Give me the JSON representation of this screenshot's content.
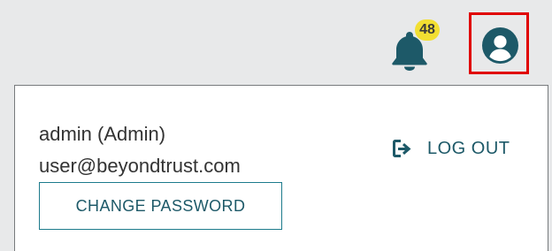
{
  "header": {
    "notifications": {
      "count": "48",
      "icon": "bell-icon",
      "badge_color": "#f2df32",
      "icon_color": "#1d5968"
    },
    "profile": {
      "icon": "user-circle-icon",
      "highlight_color": "#e00000"
    }
  },
  "account_menu": {
    "name": "admin (Admin)",
    "email": "user@beyondtrust.com",
    "change_password_label": "CHANGE PASSWORD",
    "logout_label": "LOG OUT",
    "logout_icon": "sign-out-icon",
    "accent_color": "#1d5968"
  }
}
